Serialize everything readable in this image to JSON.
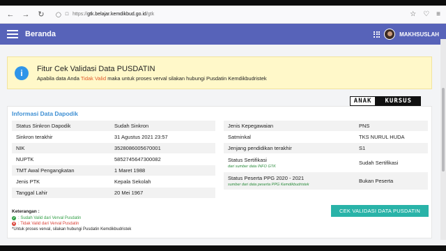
{
  "browser": {
    "url_prefix": "https://",
    "url_host": "gtk.belajar.kemdikbud.go.id",
    "url_path": "/gtk"
  },
  "appbar": {
    "title": "Beranda",
    "user_name": "MAKHSUSLAH"
  },
  "alert": {
    "title": "Fitur Cek Validasi Data PUSDATIN",
    "text_before": "Apabila data Anda ",
    "text_warn": "Tidak Valid",
    "text_after": " maka untuk proses verval silakan hubungi Pusdatin Kemdikbudristek"
  },
  "logo": {
    "part_a": "ANAK",
    "part_b": "KURSUS"
  },
  "card": {
    "title": "Informasi Data Dapodik",
    "left_rows": [
      {
        "label": "Status Sinkron Dapodik",
        "value": "Sudah Sinkron"
      },
      {
        "label": "Sinkron terakhir",
        "value": "31 Agustus 2021 23:57"
      },
      {
        "label": "NIK",
        "value": "3528086005670001"
      },
      {
        "label": "NUPTK",
        "value": "5852745647300082"
      },
      {
        "label": "TMT Awal Pengangkatan",
        "value": "1 Maret 1988"
      },
      {
        "label": "Jenis PTK",
        "value": "Kepala Sekolah"
      },
      {
        "label": "Tanggal Lahir",
        "value": "20 Mei 1967"
      }
    ],
    "right_rows": [
      {
        "label": "Jenis Kepegawaian",
        "value": "PNS"
      },
      {
        "label": "Satminkal",
        "value": "TKS NURUL HUDA"
      },
      {
        "label": "Jenjang pendidikan terakhir",
        "value": "S1"
      },
      {
        "label": "Status Sertifikasi",
        "note": "dari sumber data INFO GTK",
        "value": "Sudah Sertifikasi"
      },
      {
        "label": "Status Peserta PPG 2020 - 2021",
        "note": "sumber dari data peserta PPG Kemdikbudristek",
        "value": "Bukan Peserta"
      }
    ],
    "legend": {
      "title": "Keterangan :",
      "ok": ": Sudah Valid dari Verval Pusdatin",
      "bad": ": Tidak Valid dari Verval Pusdatin",
      "note": "*Untuk proses verval, silakan hubungi Pusdatin Kemdikbudristek"
    },
    "cta_label": "CEK VALIDASI DATA PUSDATIN"
  }
}
